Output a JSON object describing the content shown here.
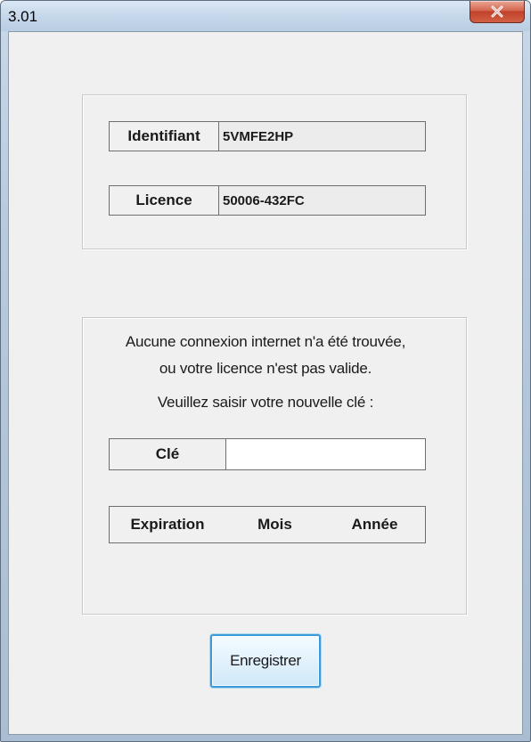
{
  "window": {
    "title": "3.01",
    "close_icon": "close-x-icon"
  },
  "info": {
    "identifiant_label": "Identifiant",
    "identifiant_value": "5VMFE2HP",
    "licence_label": "Licence",
    "licence_value": "50006-432FC"
  },
  "message": {
    "line1": "Aucune connexion internet n'a été trouvée,",
    "line2": "ou votre licence n'est pas valide.",
    "line3": "Veuillez saisir votre nouvelle clé :"
  },
  "key": {
    "label": "Clé",
    "value": "",
    "placeholder": ""
  },
  "expiration": {
    "label": "Expiration",
    "month": "Mois",
    "year": "Année"
  },
  "buttons": {
    "save_label": "Enregistrer"
  },
  "colors": {
    "close_button": "#c9472f",
    "default_button_border": "#3c9ad6",
    "client_background": "#f0f0f0"
  }
}
